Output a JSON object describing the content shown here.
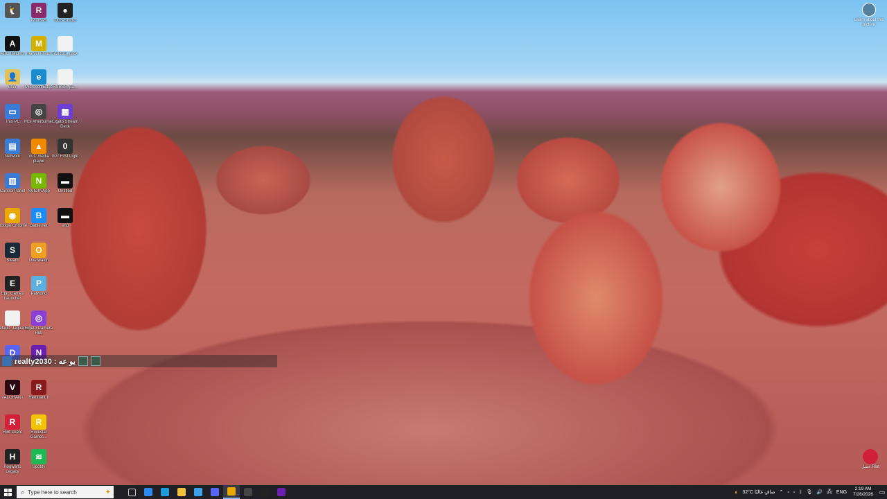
{
  "desktop": {
    "icons": [
      {
        "label": "",
        "color": "#555555",
        "glyph": "🐧"
      },
      {
        "label": "WinRAR",
        "color": "#8a2a6a",
        "glyph": "R"
      },
      {
        "label": "OBS Studio",
        "color": "#222222",
        "glyph": "●"
      },
      {
        "label": "ARC Raiders",
        "color": "#111111",
        "glyph": "A"
      },
      {
        "label": "Marvel Rivals",
        "color": "#d4b100",
        "glyph": "M"
      },
      {
        "label": "RSRSS_pack",
        "color": "#f2f2f2",
        "glyph": ""
      },
      {
        "label": "user",
        "color": "#e2c15a",
        "glyph": "👤"
      },
      {
        "label": "Microsoft Edge",
        "color": "#1b8bd0",
        "glyph": "e"
      },
      {
        "label": "RSRSS_pa...",
        "color": "#f2f2f2",
        "glyph": ""
      },
      {
        "label": "This PC",
        "color": "#3a7bd5",
        "glyph": "▭"
      },
      {
        "label": "MSI Afterburner",
        "color": "#444444",
        "glyph": "◎"
      },
      {
        "label": "Elgato Stream Deck",
        "color": "#6b3fd6",
        "glyph": "▦"
      },
      {
        "label": "Network",
        "color": "#3a7bd5",
        "glyph": "▤"
      },
      {
        "label": "VLC media player",
        "color": "#f28a00",
        "glyph": "▲"
      },
      {
        "label": "007 First Light",
        "color": "#333333",
        "glyph": "0"
      },
      {
        "label": "Control Panel",
        "color": "#3a7bd5",
        "glyph": "▥"
      },
      {
        "label": "NVIDIA App",
        "color": "#76b900",
        "glyph": "N"
      },
      {
        "label": "Untitled",
        "color": "#111111",
        "glyph": "▬"
      },
      {
        "label": "Google Chrome",
        "color": "#e8a800",
        "glyph": "◉"
      },
      {
        "label": "Battle.net",
        "color": "#1a8cff",
        "glyph": "B"
      },
      {
        "label": "end",
        "color": "#111111",
        "glyph": "▬"
      },
      {
        "label": "Steam",
        "color": "#1b2838",
        "glyph": "S"
      },
      {
        "label": "Overwatch",
        "color": "#f0a020",
        "glyph": "O"
      },
      {
        "label": "Epic Games Launcher",
        "color": "#222222",
        "glyph": "E"
      },
      {
        "label": "Palworld",
        "color": "#5ab0e0",
        "glyph": "P"
      },
      {
        "label": "Default_Jaguarvive...",
        "color": "#f2f2f2",
        "glyph": ""
      },
      {
        "label": "Elgato Camera Hub",
        "color": "#8a3fd6",
        "glyph": "◎"
      },
      {
        "label": "Discord",
        "color": "#5865f2",
        "glyph": "D"
      },
      {
        "label": "NZXT",
        "color": "#6a1fb0",
        "glyph": "N"
      },
      {
        "label": "VALORANT",
        "color": "#2a0a10",
        "glyph": "V"
      },
      {
        "label": "Remnant II",
        "color": "#8a1a1a",
        "glyph": "R"
      },
      {
        "label": "Riot Client",
        "color": "#d0203a",
        "glyph": "R"
      },
      {
        "label": "Rockstar Games...",
        "color": "#f5c400",
        "glyph": "R"
      },
      {
        "label": "Hogwarts Legacy",
        "color": "#222222",
        "glyph": "H"
      },
      {
        "label": "Spotify",
        "color": "#1db954",
        "glyph": "≋"
      }
    ]
  },
  "chat_overlay": {
    "text": "realty2030 : يو عه"
  },
  "learn_more": {
    "label": "Learn about this picture"
  },
  "riot_shortcut": {
    "label": "عميل Riot"
  },
  "taskbar": {
    "search_placeholder": "Type here to search",
    "apps": [
      {
        "name": "task-view",
        "color": "#cccccc"
      },
      {
        "name": "edge-copilot",
        "color": "#2a8af0"
      },
      {
        "name": "edge",
        "color": "#1b9bd8"
      },
      {
        "name": "file-explorer",
        "color": "#f0c040"
      },
      {
        "name": "store",
        "color": "#3aa0e8"
      },
      {
        "name": "discord",
        "color": "#5865f2"
      },
      {
        "name": "chrome",
        "color": "#e8a800"
      },
      {
        "name": "terminal",
        "color": "#444444"
      },
      {
        "name": "obs",
        "color": "#222222"
      },
      {
        "name": "nzxt",
        "color": "#6a1fb0"
      }
    ],
    "weather": "32°C  صافٍ غالبًا",
    "language": "ENG",
    "time": "2:19 AM",
    "date": "7/26/2026"
  }
}
